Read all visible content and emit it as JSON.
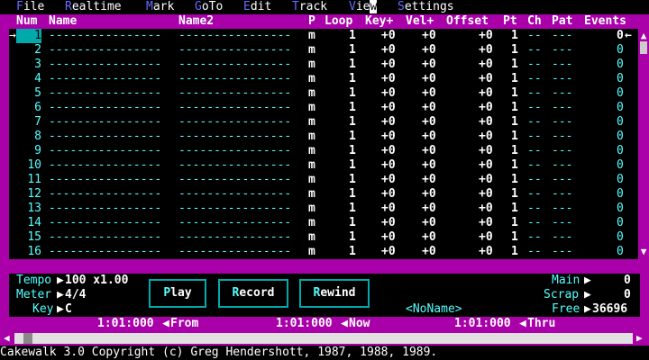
{
  "menu": [
    {
      "hot": "F",
      "rest": "ile"
    },
    {
      "hot": "R",
      "rest": "ealtime"
    },
    {
      "hot": "M",
      "rest": "ark"
    },
    {
      "hot": "G",
      "rest": "oTo"
    },
    {
      "hot": "E",
      "rest": "dit"
    },
    {
      "hot": "T",
      "rest": "rack"
    },
    {
      "hot": "V",
      "rest": "ie",
      "last": "w"
    },
    {
      "hot": "S",
      "rest": "ettings"
    }
  ],
  "columns": {
    "num": "Num",
    "name": "Name",
    "name2": "Name2",
    "p": "P",
    "loop": "Loop",
    "key": "Key+",
    "vel": "Vel+",
    "offset": "Offset",
    "pt": "Pt",
    "ch": "Ch",
    "pat": "Pat",
    "events": "Events"
  },
  "tracks": [
    {
      "num": "1",
      "name": "----------------",
      "name2": "----------------",
      "p": "m",
      "loop": "1",
      "key": "+0",
      "vel": "+0",
      "offset": "+0",
      "pt": "1",
      "ch": "--",
      "pat": "---",
      "events": "0"
    },
    {
      "num": "2",
      "name": "----------------",
      "name2": "----------------",
      "p": "m",
      "loop": "1",
      "key": "+0",
      "vel": "+0",
      "offset": "+0",
      "pt": "1",
      "ch": "--",
      "pat": "---",
      "events": "0"
    },
    {
      "num": "3",
      "name": "----------------",
      "name2": "----------------",
      "p": "m",
      "loop": "1",
      "key": "+0",
      "vel": "+0",
      "offset": "+0",
      "pt": "1",
      "ch": "--",
      "pat": "---",
      "events": "0"
    },
    {
      "num": "4",
      "name": "----------------",
      "name2": "----------------",
      "p": "m",
      "loop": "1",
      "key": "+0",
      "vel": "+0",
      "offset": "+0",
      "pt": "1",
      "ch": "--",
      "pat": "---",
      "events": "0"
    },
    {
      "num": "5",
      "name": "----------------",
      "name2": "----------------",
      "p": "m",
      "loop": "1",
      "key": "+0",
      "vel": "+0",
      "offset": "+0",
      "pt": "1",
      "ch": "--",
      "pat": "---",
      "events": "0"
    },
    {
      "num": "6",
      "name": "----------------",
      "name2": "----------------",
      "p": "m",
      "loop": "1",
      "key": "+0",
      "vel": "+0",
      "offset": "+0",
      "pt": "1",
      "ch": "--",
      "pat": "---",
      "events": "0"
    },
    {
      "num": "7",
      "name": "----------------",
      "name2": "----------------",
      "p": "m",
      "loop": "1",
      "key": "+0",
      "vel": "+0",
      "offset": "+0",
      "pt": "1",
      "ch": "--",
      "pat": "---",
      "events": "0"
    },
    {
      "num": "8",
      "name": "----------------",
      "name2": "----------------",
      "p": "m",
      "loop": "1",
      "key": "+0",
      "vel": "+0",
      "offset": "+0",
      "pt": "1",
      "ch": "--",
      "pat": "---",
      "events": "0"
    },
    {
      "num": "9",
      "name": "----------------",
      "name2": "----------------",
      "p": "m",
      "loop": "1",
      "key": "+0",
      "vel": "+0",
      "offset": "+0",
      "pt": "1",
      "ch": "--",
      "pat": "---",
      "events": "0"
    },
    {
      "num": "10",
      "name": "----------------",
      "name2": "----------------",
      "p": "m",
      "loop": "1",
      "key": "+0",
      "vel": "+0",
      "offset": "+0",
      "pt": "1",
      "ch": "--",
      "pat": "---",
      "events": "0"
    },
    {
      "num": "11",
      "name": "----------------",
      "name2": "----------------",
      "p": "m",
      "loop": "1",
      "key": "+0",
      "vel": "+0",
      "offset": "+0",
      "pt": "1",
      "ch": "--",
      "pat": "---",
      "events": "0"
    },
    {
      "num": "12",
      "name": "----------------",
      "name2": "----------------",
      "p": "m",
      "loop": "1",
      "key": "+0",
      "vel": "+0",
      "offset": "+0",
      "pt": "1",
      "ch": "--",
      "pat": "---",
      "events": "0"
    },
    {
      "num": "13",
      "name": "----------------",
      "name2": "----------------",
      "p": "m",
      "loop": "1",
      "key": "+0",
      "vel": "+0",
      "offset": "+0",
      "pt": "1",
      "ch": "--",
      "pat": "---",
      "events": "0"
    },
    {
      "num": "14",
      "name": "----------------",
      "name2": "----------------",
      "p": "m",
      "loop": "1",
      "key": "+0",
      "vel": "+0",
      "offset": "+0",
      "pt": "1",
      "ch": "--",
      "pat": "---",
      "events": "0"
    },
    {
      "num": "15",
      "name": "----------------",
      "name2": "----------------",
      "p": "m",
      "loop": "1",
      "key": "+0",
      "vel": "+0",
      "offset": "+0",
      "pt": "1",
      "ch": "--",
      "pat": "---",
      "events": "0"
    },
    {
      "num": "16",
      "name": "----------------",
      "name2": "----------------",
      "p": "m",
      "loop": "1",
      "key": "+0",
      "vel": "+0",
      "offset": "+0",
      "pt": "1",
      "ch": "--",
      "pat": "---",
      "events": "0"
    }
  ],
  "selected_row_marker": "→",
  "events_cursor": "←",
  "panel": {
    "tempo_label": "Tempo",
    "tempo_value": "100 x1.00",
    "meter_label": "Meter",
    "meter_value": "4/4",
    "key_label": "Key",
    "key_value": "C",
    "play": {
      "hot": "P",
      "rest": "lay"
    },
    "record": {
      "hot": "R",
      "rest": "ecord"
    },
    "rewind": {
      "hot": "R",
      "rest": "ewind"
    },
    "main_label": "Main",
    "main_value": "0",
    "scrap_label": "Scrap",
    "scrap_value": "0",
    "free_label": "Free",
    "free_value": "36696",
    "song_name": "<NoName>"
  },
  "timeline": {
    "from_value": "1:01:000",
    "from_label": "From",
    "now_value": "1:01:000",
    "now_label": "Now",
    "thru_value": "1:01:000",
    "thru_label": "Thru"
  },
  "status": "Cakewalk 3.0 Copyright (c) Greg Hendershott, 1987, 1988, 1989.",
  "colors": {
    "frame": "#aa00aa",
    "cyan": "#55ffff",
    "teal": "#00aaaa"
  }
}
